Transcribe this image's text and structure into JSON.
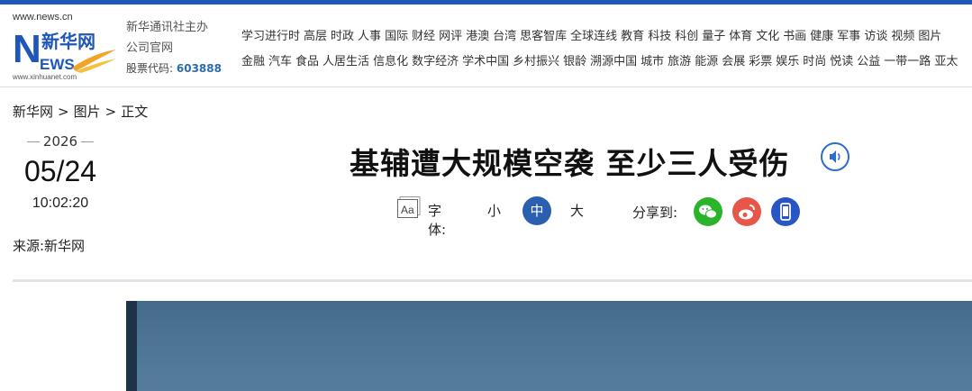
{
  "header": {
    "logo_url_top": "www.news.cn",
    "logo_url_bottom": "www.xinhuanet.com",
    "logo_cn": "新华网",
    "logo_en": "EWS",
    "sponsor_line1": "新华通讯社主办",
    "sponsor_line2": "公司官网",
    "stock_label": "股票代码:",
    "stock_code": "603888",
    "nav_row1": [
      "学习进行时",
      "高层",
      "时政",
      "人事",
      "国际",
      "财经",
      "网评",
      "港澳",
      "台湾",
      "思客智库",
      "全球连线",
      "教育",
      "科技",
      "科创",
      "量子",
      "体育",
      "文化",
      "书画",
      "健康",
      "军事",
      "访谈",
      "视频",
      "图片"
    ],
    "nav_row2": [
      "金融",
      "汽车",
      "食品",
      "人居生活",
      "信息化",
      "数字经济",
      "学术中国",
      "乡村振兴",
      "银龄",
      "溯源中国",
      "城市",
      "旅游",
      "能源",
      "会展",
      "彩票",
      "娱乐",
      "时尚",
      "悦读",
      "公益",
      "一带一路",
      "亚太"
    ]
  },
  "breadcrumb": {
    "site": "新华网",
    "sep1": ">",
    "section": "图片",
    "sep2": ">",
    "page": "正文"
  },
  "article": {
    "year": "2026",
    "month_day": "05/24",
    "time": "10:02:20",
    "source": "来源:新华网",
    "title": "基辅遭大规模空袭 至少三人受伤"
  },
  "font_control": {
    "label": "字体:",
    "small": "小",
    "medium": "中",
    "large": "大",
    "active": "中"
  },
  "share": {
    "label": "分享到:",
    "targets": [
      "wechat-icon",
      "weibo-icon",
      "mobile-icon"
    ]
  },
  "colors": {
    "accent": "#1f57b8",
    "wechat": "#2bb42b",
    "weibo": "#e8564a",
    "mobile": "#2856c6",
    "active_font": "#2b5fb0"
  }
}
